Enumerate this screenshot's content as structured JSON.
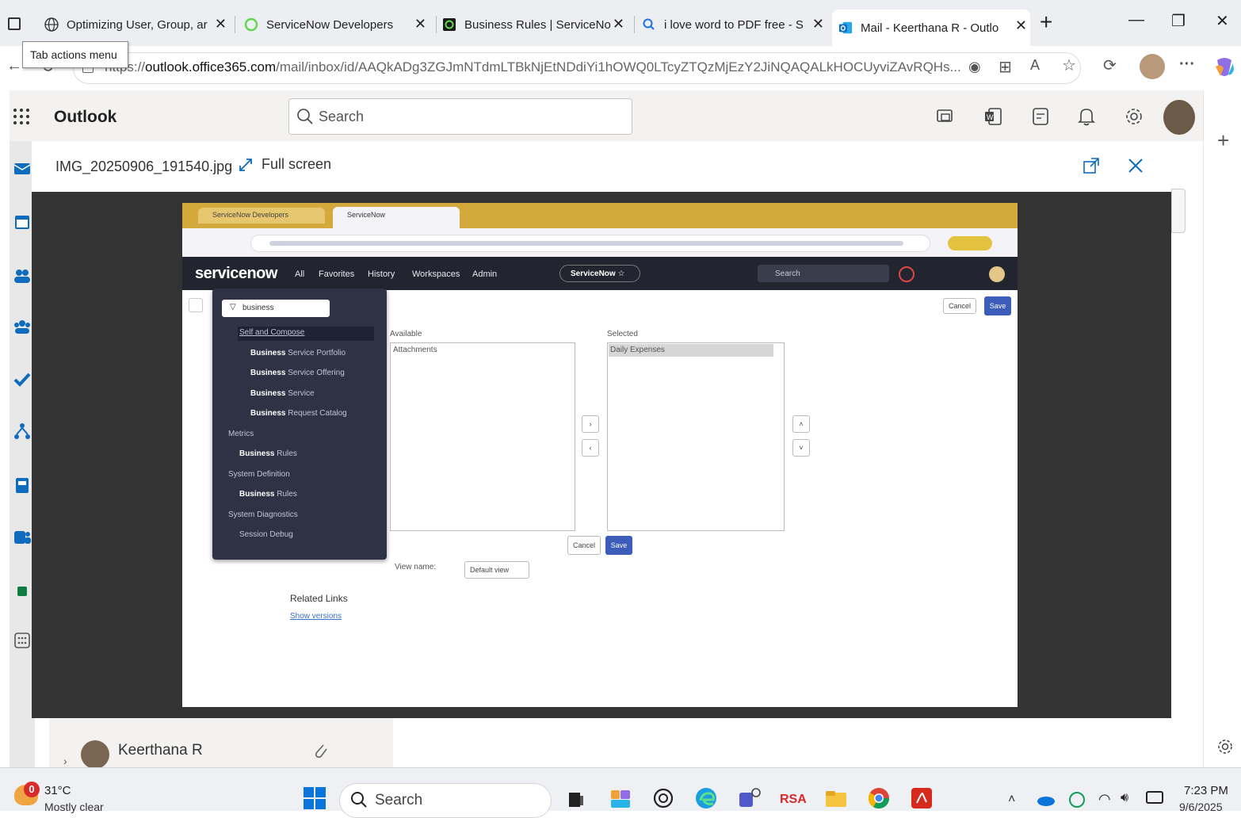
{
  "browser": {
    "tabs": [
      {
        "title": "Optimizing User, Group, ar",
        "icon": "globe-icon",
        "active": false
      },
      {
        "title": "ServiceNow Developers",
        "icon": "servicenow-icon",
        "active": false
      },
      {
        "title": "Business Rules | ServiceNo",
        "icon": "servicenow-app-icon",
        "active": false
      },
      {
        "title": "i love word to PDF free - S",
        "icon": "search-icon",
        "active": false
      },
      {
        "title": "Mail - Keerthana R - Outlo",
        "icon": "outlook-icon",
        "active": true
      }
    ],
    "new_tab": "+",
    "tooltip": "Tab actions menu",
    "url_prefix": "https://",
    "url_host": "outlook.office365.com",
    "url_path": "/mail/inbox/id/AAQkADg3ZGJmNTdmLTBkNjEtNDdiYi1hOWQ0LTcyZTQzMjEzY2JiNQAQALkHOCUyviZAvRQHs..."
  },
  "outlook": {
    "app_name": "Outlook",
    "search_placeholder": "Search",
    "colors": {
      "accent": "#0f6cbd",
      "header_bg": "#f3f2f1"
    }
  },
  "viewer": {
    "filename": "IMG_20250906_191540.jpg",
    "fullscreen_label": "Full screen"
  },
  "photo": {
    "tab1": "ServiceNow Developers",
    "tab2": "ServiceNow",
    "brand": "servicenow",
    "nav": [
      "All",
      "Favorites",
      "History",
      "Workspaces",
      "Admin"
    ],
    "instance": "ServiceNow ☆",
    "search": "Search",
    "filter_value": "business",
    "menu": [
      {
        "text": "Self and Compose",
        "bold": "",
        "indent": 2
      },
      {
        "text": " Service Portfolio",
        "bold": "Business",
        "indent": 3
      },
      {
        "text": " Service Offering",
        "bold": "Business",
        "indent": 3
      },
      {
        "text": " Service",
        "bold": "Business",
        "indent": 3
      },
      {
        "text": " Request Catalog",
        "bold": "Business",
        "indent": 3
      },
      {
        "text": "Metrics",
        "bold": "",
        "indent": 1
      },
      {
        "text": " Rules",
        "bold": "Business",
        "indent": 2
      },
      {
        "text": "System Definition",
        "bold": "",
        "indent": 1
      },
      {
        "text": " Rules",
        "bold": "Business",
        "indent": 2
      },
      {
        "text": "System Diagnostics",
        "bold": "",
        "indent": 1
      },
      {
        "text": "Session Debug",
        "bold": "",
        "indent": 2
      }
    ],
    "available_label": "Available",
    "available_item": "Attachments",
    "selected_label": "Selected",
    "selected_item": "Daily Expenses",
    "cancel": "Cancel",
    "save": "Save",
    "view_name_label": "View name:",
    "view_name_value": "Default view",
    "related_links": "Related Links",
    "show_versions": "Show versions"
  },
  "mail": {
    "sender": "Keerthana R"
  },
  "taskbar": {
    "weather_temp": "31°C",
    "weather_desc": "Mostly clear",
    "weather_badge": "0",
    "search_placeholder": "Search",
    "time": "7:23 PM",
    "date": "9/6/2025"
  }
}
